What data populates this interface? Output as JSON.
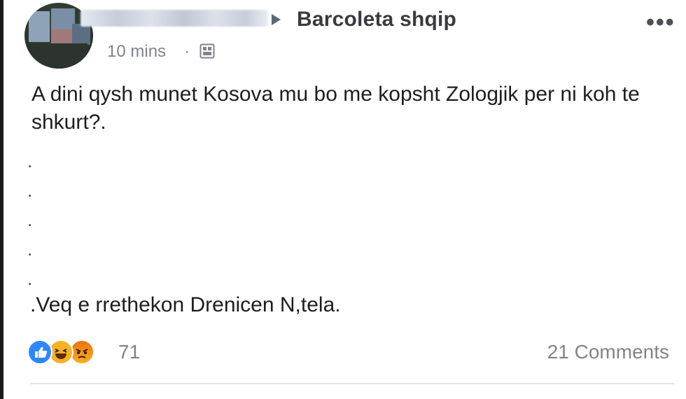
{
  "post": {
    "group_name": "Barcoleta shqip",
    "timestamp": "10 mins",
    "meta_separator": "·",
    "audience_icon": "group-members-icon",
    "more_menu": "•••",
    "body_text": "A dini qysh munet Kosova mu bo me kopsht Zologjik per ni koh te shkurt?.",
    "dot_lines": [
      ".",
      ".",
      ".",
      ".",
      "."
    ],
    "closing_text": ".Veq e rrethekon Drenicen N,tela."
  },
  "footer": {
    "reaction_icons": [
      "like-icon",
      "haha-icon",
      "angry-icon"
    ],
    "reaction_count": "71",
    "comments_label": "21 Comments"
  },
  "colors": {
    "like": "#2d88ff",
    "haha": "#f7b125",
    "angry": "#e9710f",
    "meta_text": "#7f848b",
    "body_text": "#1c1e21"
  }
}
